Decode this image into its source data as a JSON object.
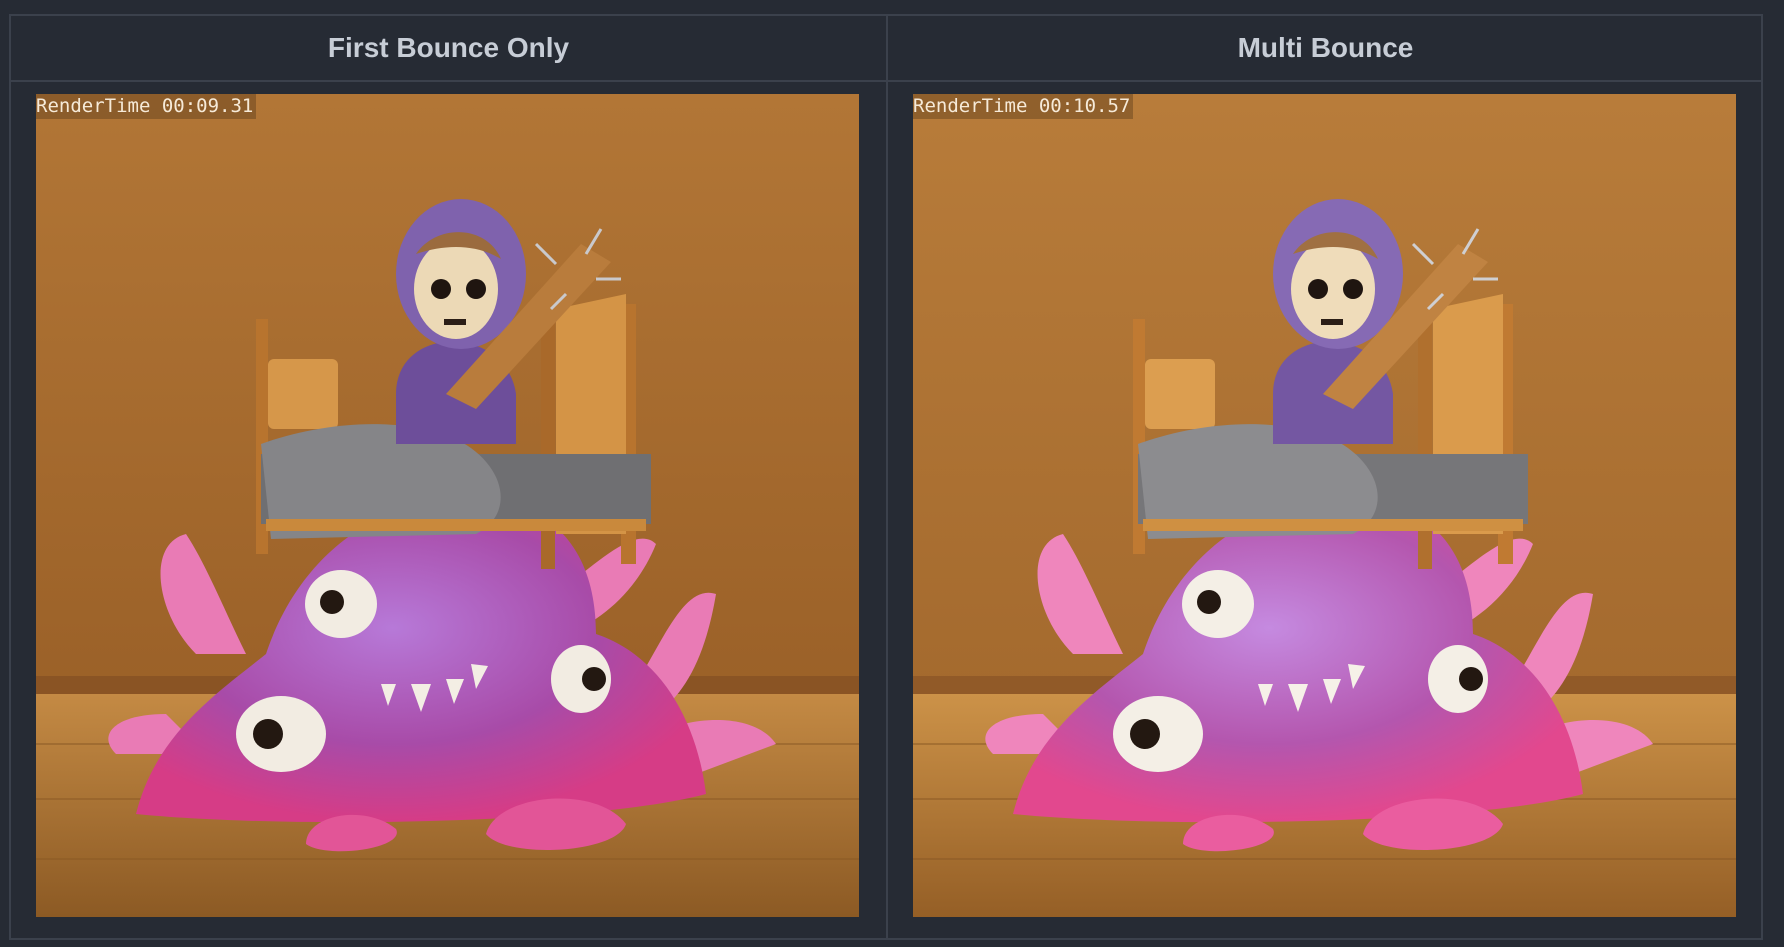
{
  "columns": [
    {
      "title": "First Bounce Only",
      "render_time_label": "RenderTime 00:09.31"
    },
    {
      "title": "Multi Bounce",
      "render_time_label": "RenderTime 00:10.57"
    }
  ],
  "image": {
    "subject": "slasher-kid-on-bed-with-slime-monster",
    "colors": {
      "wall": "#a86d32",
      "floor": "#b0742e",
      "hoodie": "#7a5ca6",
      "slime": "#c6429e",
      "bed_wood": "#c98b3c",
      "blanket": "#6e6e70"
    }
  }
}
